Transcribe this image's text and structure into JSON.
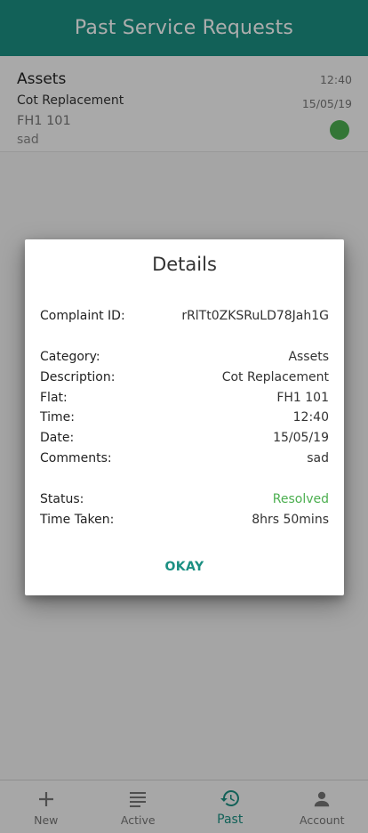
{
  "header": {
    "title": "Past Service Requests"
  },
  "requests": [
    {
      "category": "Assets",
      "time": "12:40",
      "description": "Cot Replacement",
      "date": "15/05/19",
      "flat": "FH1 101",
      "comments": "sad",
      "status_color": "#4caf50"
    }
  ],
  "dialog": {
    "title": "Details",
    "complaint_id_label": "Complaint ID:",
    "complaint_id": "rRlTt0ZKSRuLD78Jah1G",
    "category_label": "Category:",
    "category": "Assets",
    "description_label": "Description:",
    "description": "Cot Replacement",
    "flat_label": "Flat:",
    "flat": "FH1 101",
    "time_label": "Time:",
    "time": "12:40",
    "date_label": "Date:",
    "date": "15/05/19",
    "comments_label": "Comments:",
    "comments": "sad",
    "status_label": "Status:",
    "status": "Resolved",
    "time_taken_label": "Time Taken:",
    "time_taken": "8hrs 50mins",
    "okay_label": "OKAY"
  },
  "bottom_nav": {
    "items": [
      {
        "label": "New",
        "icon": "plus-icon"
      },
      {
        "label": "Active",
        "icon": "list-icon"
      },
      {
        "label": "Past",
        "icon": "history-icon",
        "active": true
      },
      {
        "label": "Account",
        "icon": "person-icon"
      }
    ]
  },
  "colors": {
    "primary": "#1b8f82",
    "resolved": "#4caf50"
  }
}
